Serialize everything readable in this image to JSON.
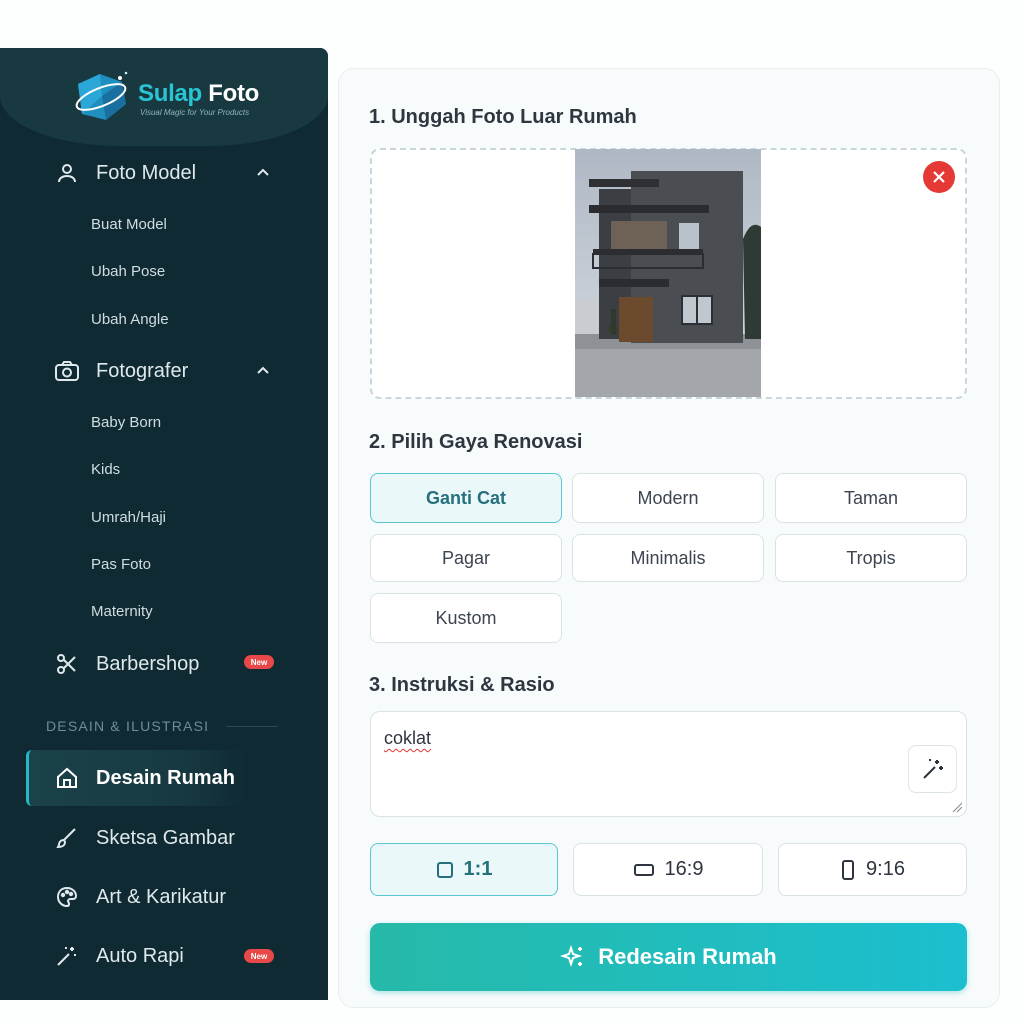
{
  "brand": {
    "title_1": "Sulap",
    "title_2": "Foto",
    "tagline": "Visual Magic for Your Products"
  },
  "sidebar": {
    "groups": [
      {
        "label": "Foto Model",
        "icon": "user-icon",
        "items": [
          "Buat Model",
          "Ubah Pose",
          "Ubah Angle"
        ]
      },
      {
        "label": "Fotografer",
        "icon": "camera-icon",
        "items": [
          "Baby Born",
          "Kids",
          "Umrah/Haji",
          "Pas Foto",
          "Maternity"
        ]
      }
    ],
    "barbershop": {
      "label": "Barbershop",
      "badge": "New",
      "icon": "scissors-icon"
    },
    "section_title": "DESAIN & ILUSTRASI",
    "design_items": [
      {
        "label": "Desain Rumah",
        "icon": "home-icon",
        "active": true
      },
      {
        "label": "Sketsa Gambar",
        "icon": "brush-icon"
      },
      {
        "label": "Art & Karikatur",
        "icon": "palette-icon"
      },
      {
        "label": "Auto Rapi",
        "icon": "wand-sparkle-icon",
        "badge": "New"
      }
    ]
  },
  "main": {
    "step1": "1. Unggah Foto Luar Rumah",
    "step2": "2. Pilih Gaya Renovasi",
    "styles": [
      "Ganti Cat",
      "Modern",
      "Taman",
      "Pagar",
      "Minimalis",
      "Tropis",
      "Kustom"
    ],
    "selected_style": "Ganti Cat",
    "step3": "3. Instruksi & Rasio",
    "instruction_value": "coklat",
    "ratios": [
      "1:1",
      "16:9",
      "9:16"
    ],
    "selected_ratio": "1:1",
    "submit_label": "Redesain Rumah"
  },
  "colors": {
    "sidebar_bg": "#0f2a33",
    "accent": "#1cbfd0",
    "danger": "#e53935"
  }
}
